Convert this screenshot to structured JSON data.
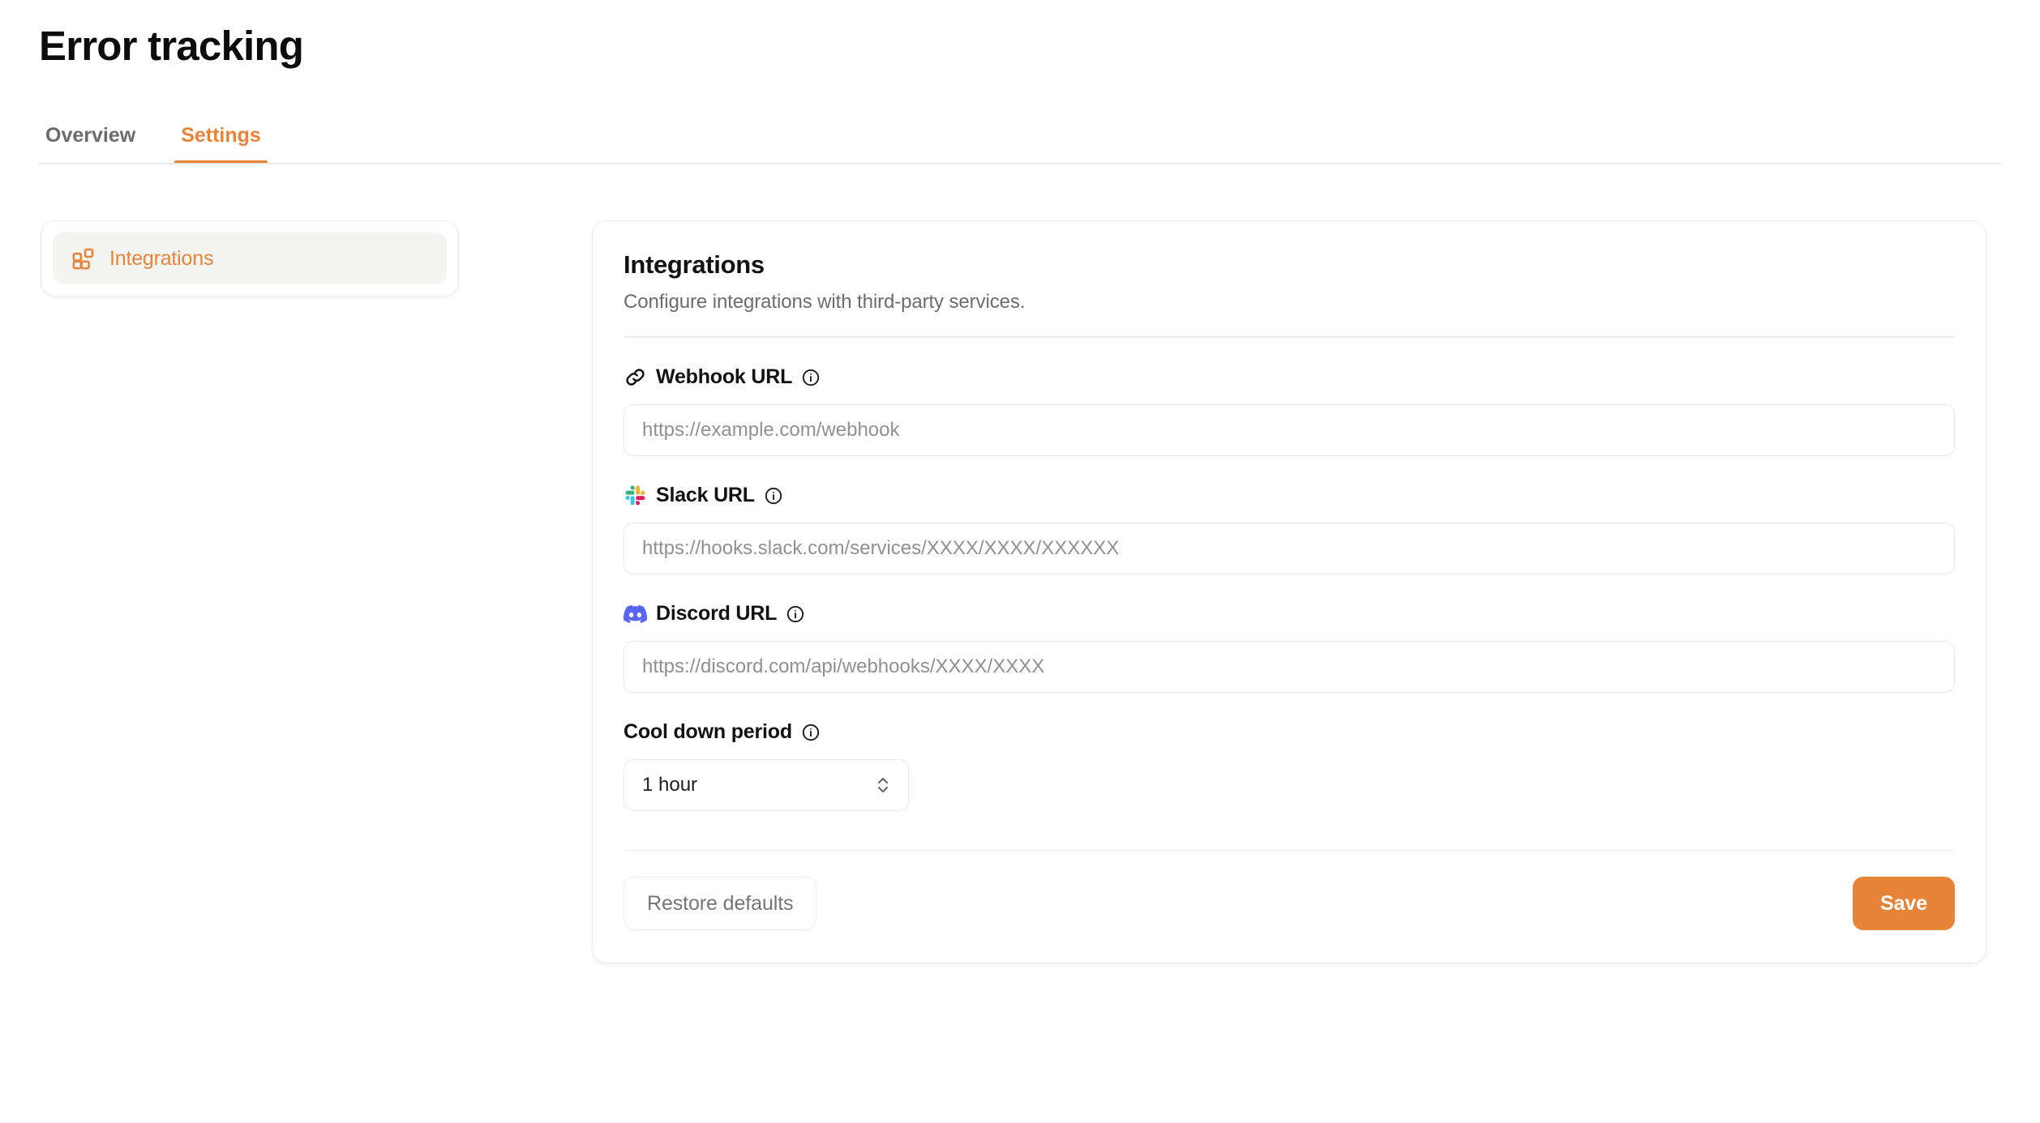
{
  "header": {
    "title": "Error tracking",
    "tabs": [
      {
        "label": "Overview",
        "active": false
      },
      {
        "label": "Settings",
        "active": true
      }
    ]
  },
  "sidebar": {
    "items": [
      {
        "label": "Integrations",
        "icon": "blocks-icon",
        "active": true
      }
    ]
  },
  "panel": {
    "title": "Integrations",
    "subtitle": "Configure integrations with third-party services.",
    "fields": [
      {
        "label": "Webhook URL",
        "icon": "link-icon",
        "info": "info-icon",
        "type": "text",
        "value": "",
        "placeholder": "https://example.com/webhook"
      },
      {
        "label": "Slack URL",
        "icon": "slack-icon",
        "info": "info-icon",
        "type": "text",
        "value": "",
        "placeholder": "https://hooks.slack.com/services/XXXX/XXXX/XXXXXX"
      },
      {
        "label": "Discord URL",
        "icon": "discord-icon",
        "info": "info-icon",
        "type": "text",
        "value": "",
        "placeholder": "https://discord.com/api/webhooks/XXXX/XXXX"
      },
      {
        "label": "Cool down period",
        "icon": "",
        "info": "info-icon",
        "type": "select",
        "value": "1 hour",
        "placeholder": ""
      }
    ],
    "footer": {
      "restore_label": "Restore defaults",
      "save_label": "Save"
    }
  },
  "colors": {
    "accent": "#e8833a",
    "slack_blue": "#36c5f0",
    "slack_green": "#2eb67d",
    "slack_red": "#e01e5a",
    "slack_yellow": "#ecb22e",
    "discord_blurple": "#5865f2",
    "border": "#ececec",
    "muted_text": "#6c6c6c"
  }
}
